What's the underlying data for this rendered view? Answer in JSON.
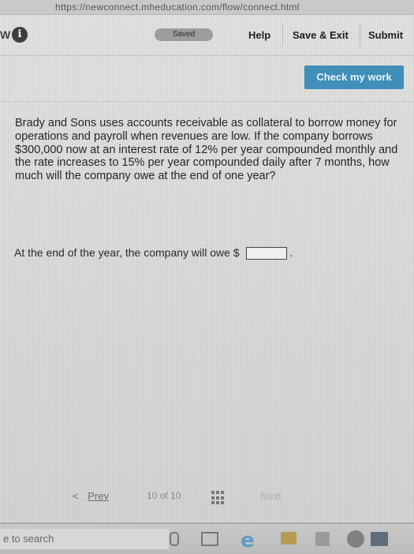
{
  "browser": {
    "url": "https://newconnect.mheducation.com/flow/connect.html"
  },
  "header": {
    "brand_fragment": "W",
    "status_badge": "Saved",
    "help_label": "Help",
    "save_exit_label": "Save & Exit",
    "submit_label": "Submit"
  },
  "actions": {
    "check_work_label": "Check my work"
  },
  "question": {
    "text": "Brady and Sons uses accounts receivable as collateral to borrow money for operations and payroll when revenues are low. If the company borrows $300,000 now at an interest rate of 12% per year compounded monthly and the rate increases to 15% per year compounded daily after 7 months, how much will the company owe at the end of one year?",
    "answer_prompt": "At the end of the year, the company will owe $",
    "answer_suffix": ".",
    "answer_value": ""
  },
  "pagination": {
    "prev_icon": "<",
    "prev_label": "Prev",
    "current": "10",
    "of_label": "of",
    "total": "10",
    "next_label": "Next"
  },
  "taskbar": {
    "search_text": "e to search"
  },
  "colors": {
    "accent": "#3f8fb8",
    "saved_badge": "#9c9c9c"
  }
}
